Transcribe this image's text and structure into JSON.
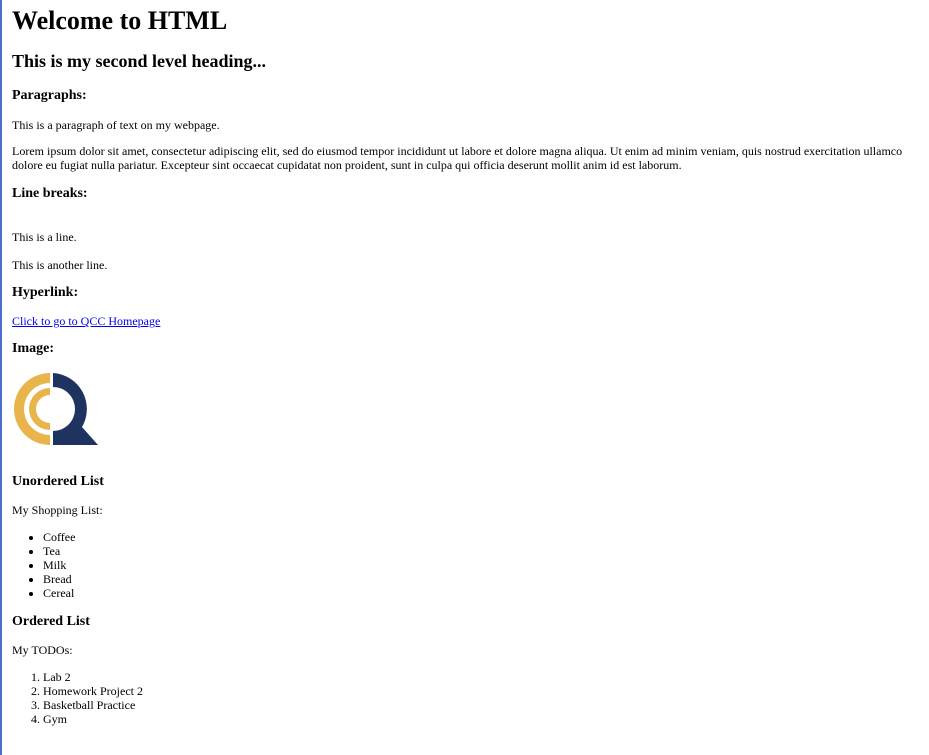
{
  "headings": {
    "welcome": "Welcome to HTML",
    "second_level": "This is my second level heading...",
    "paragraphs": "Paragraphs:",
    "line_breaks": "Line breaks:",
    "hyperlink": "Hyperlink:",
    "image": "Image:",
    "unordered_list": "Unordered List",
    "ordered_list": "Ordered List"
  },
  "paragraphs": {
    "intro": "This is a paragraph of text on my webpage.",
    "lorem": "Lorem ipsum dolor sit amet, consectetur adipiscing elit, sed do eiusmod tempor incididunt ut labore et dolore magna aliqua. Ut enim ad minim veniam, quis nostrud exercitation ullamco dolore eu fugiat nulla pariatur. Excepteur sint occaecat cupidatat non proident, sunt in culpa qui officia deserunt mollit anim id est laborum."
  },
  "line_breaks": {
    "line1": "This is a line.",
    "line2": "This is another line."
  },
  "hyperlink": {
    "text": "Click to go to QCC Homepage"
  },
  "image": {
    "logo_icon": "qcc-logo-icon",
    "colors": {
      "gold": "#e9b54a",
      "navy": "#1f3360"
    }
  },
  "shopping": {
    "label": "My Shopping List:",
    "items": [
      "Coffee",
      "Tea",
      "Milk",
      "Bread",
      "Cereal"
    ]
  },
  "todos": {
    "label": "My TODOs:",
    "items": [
      "Lab 2",
      "Homework Project 2",
      "Basketball Practice",
      "Gym"
    ]
  },
  "colors": {
    "link": "#0000ee",
    "left_rule": "#4a6fd0"
  }
}
